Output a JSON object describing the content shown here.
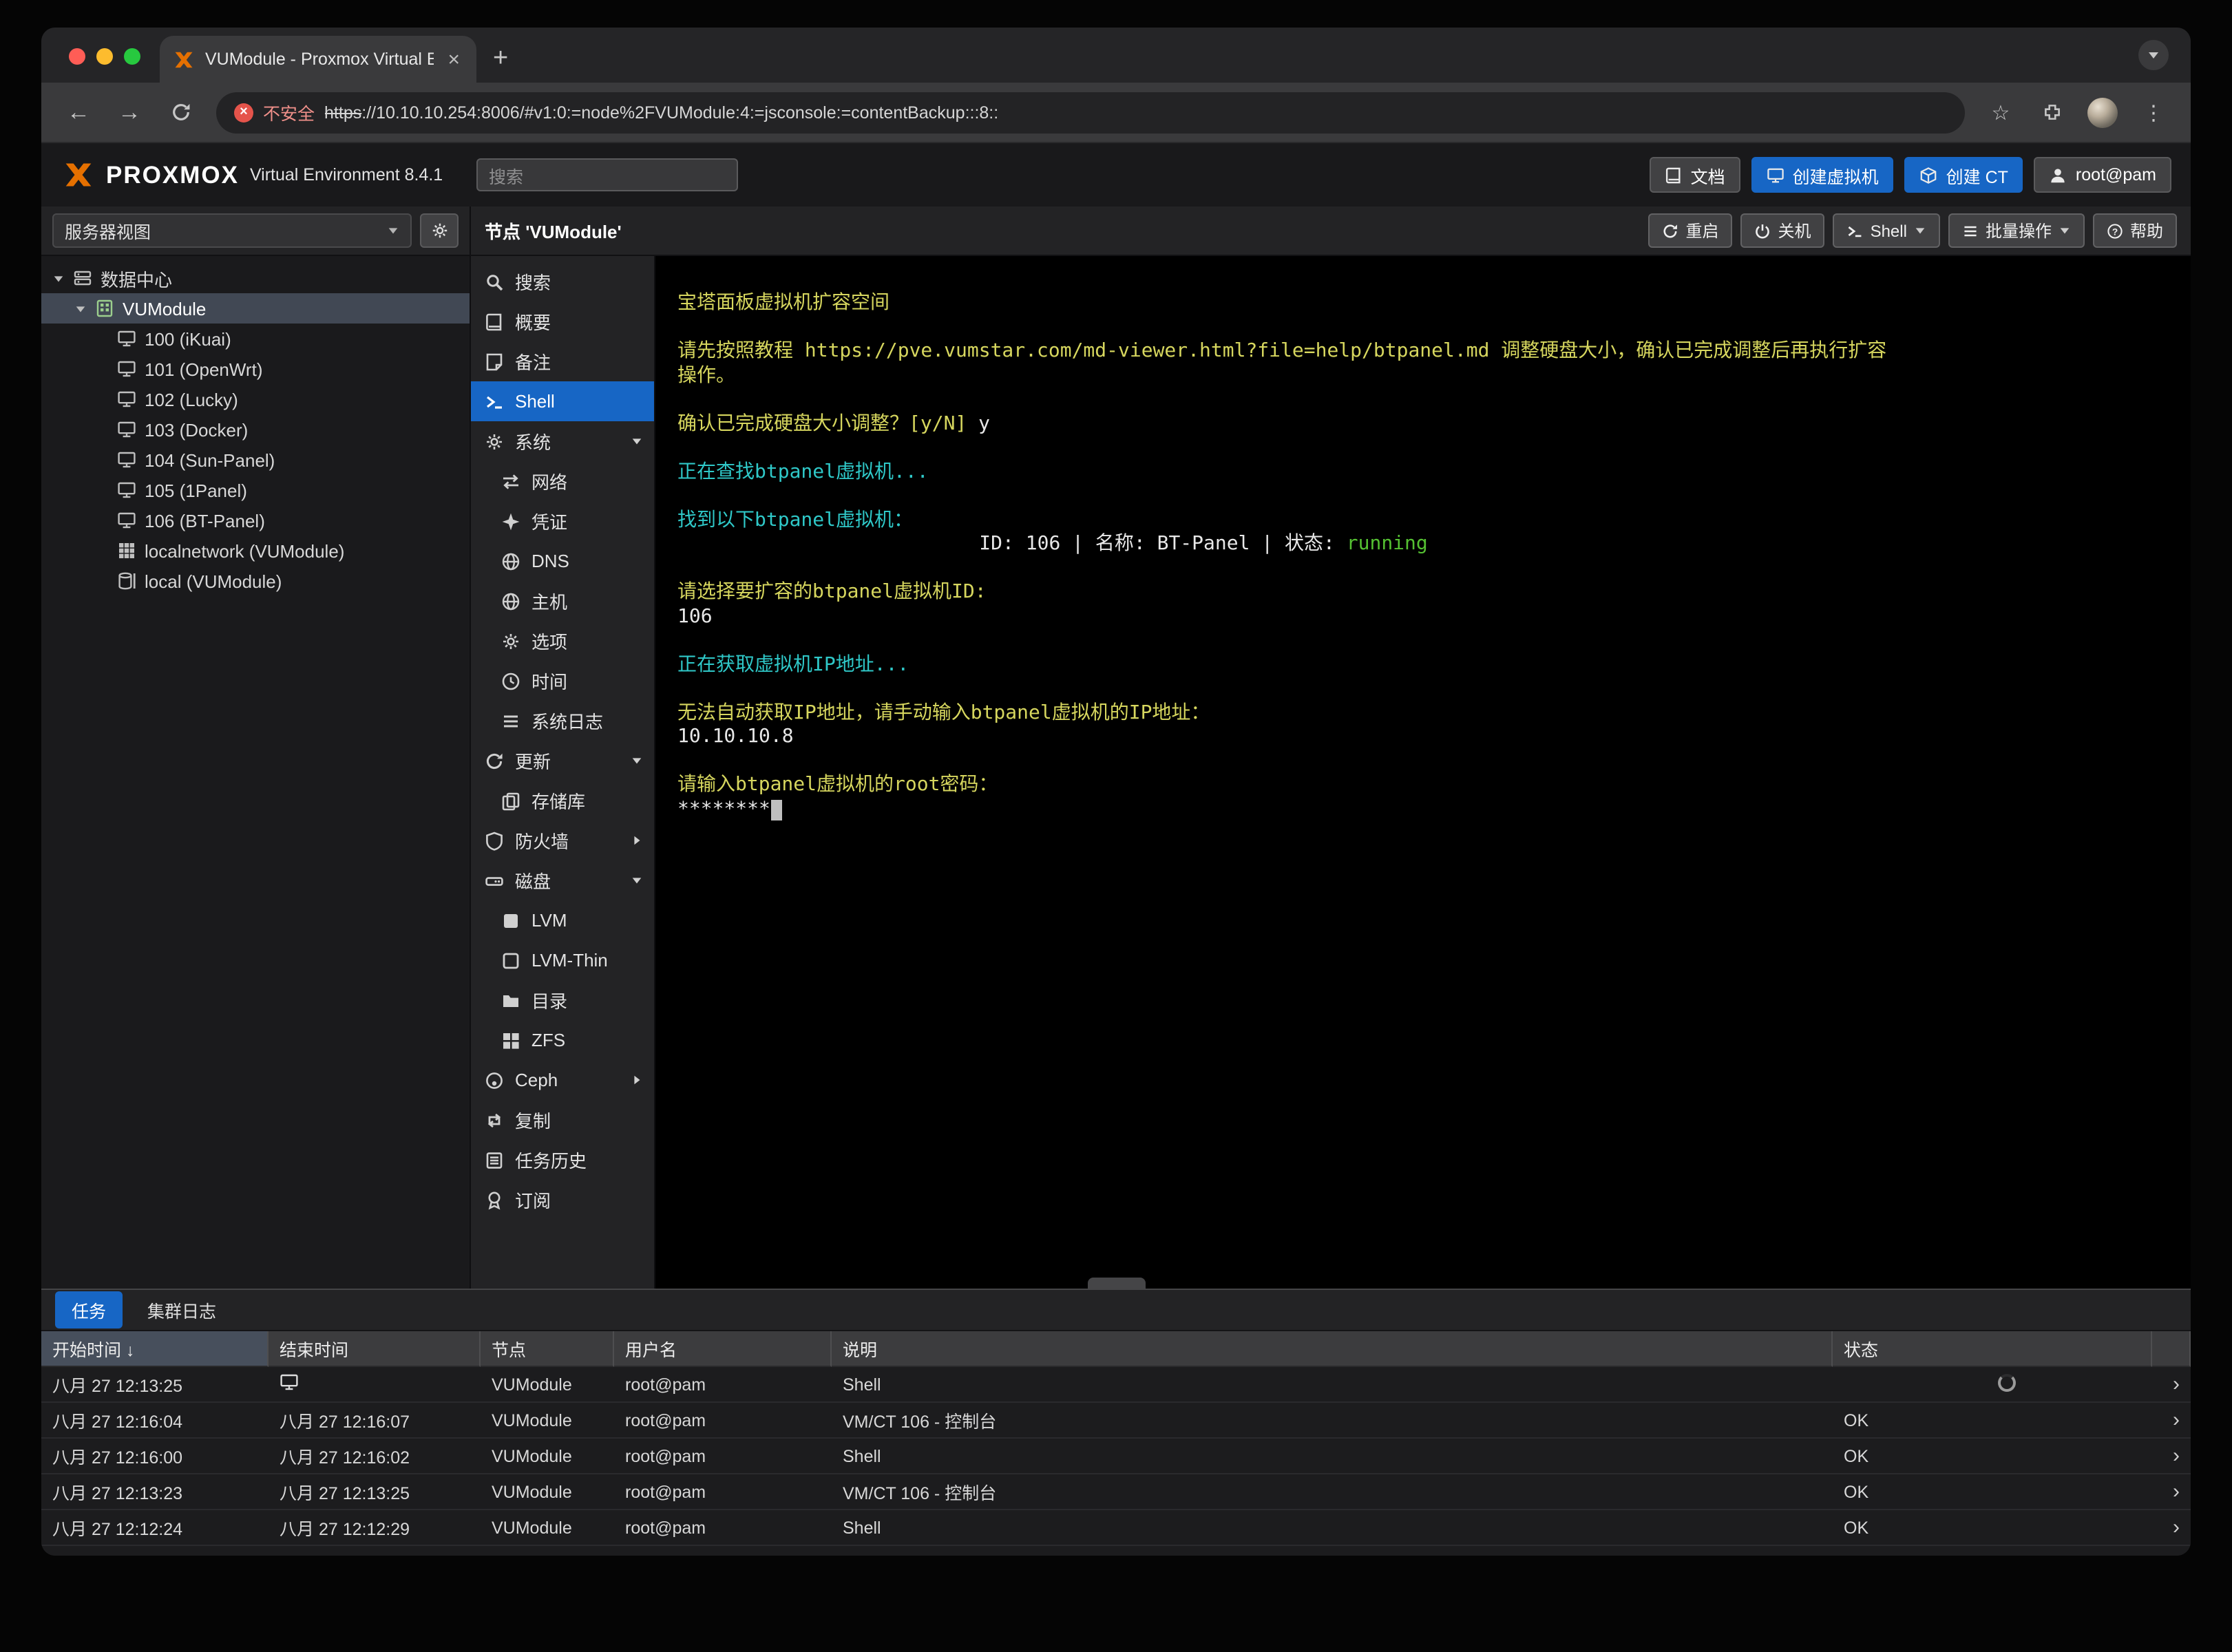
{
  "colors": {
    "accent_blue": "#1766c5",
    "brand_orange": "#e57000",
    "insecure_red": "#e5544b"
  },
  "browser": {
    "tab_title": "VUModule - Proxmox Virtual E",
    "close": "×",
    "new_tab": "+",
    "security_badge": "不安全",
    "url_scheme": "https",
    "url_rest": "://10.10.10.254:8006/#v1:0:=node%2FVUModule:4:=jsconsole:=contentBackup:::8::"
  },
  "pve_header": {
    "brand": "PROXMOX",
    "version": "Virtual Environment 8.4.1",
    "search_placeholder": "搜索",
    "buttons": [
      {
        "id": "documentation-button",
        "icon": "book",
        "label": "文档",
        "style": "dark"
      },
      {
        "id": "create-vm-button",
        "icon": "monitor",
        "label": "创建虚拟机",
        "style": "blue"
      },
      {
        "id": "create-ct-button",
        "icon": "cube",
        "label": "创建 CT",
        "style": "blue"
      },
      {
        "id": "user-menu-button",
        "icon": "user",
        "label": "root@pam",
        "style": "dark"
      }
    ]
  },
  "sidebar": {
    "view_label": "服务器视图",
    "tree": [
      {
        "id": "tree-item-datacenter",
        "icon": "server",
        "label": "数据中心",
        "level": 0,
        "caret": "down"
      },
      {
        "id": "tree-item-node-vumodule",
        "icon": "node",
        "label": "VUModule",
        "level": 1,
        "caret": "down",
        "selected": true
      },
      {
        "id": "tree-item-vm-100",
        "icon": "monitor",
        "label": "100 (iKuai)",
        "level": 2
      },
      {
        "id": "tree-item-vm-101",
        "icon": "monitor",
        "label": "101 (OpenWrt)",
        "level": 2
      },
      {
        "id": "tree-item-vm-102",
        "icon": "monitor",
        "label": "102 (Lucky)",
        "level": 2
      },
      {
        "id": "tree-item-vm-103",
        "icon": "monitor",
        "label": "103 (Docker)",
        "level": 2
      },
      {
        "id": "tree-item-vm-104",
        "icon": "monitor",
        "label": "104 (Sun-Panel)",
        "level": 2
      },
      {
        "id": "tree-item-vm-105",
        "icon": "monitor",
        "label": "105 (1Panel)",
        "level": 2
      },
      {
        "id": "tree-item-vm-106",
        "icon": "monitor",
        "label": "106 (BT-Panel)",
        "level": 2
      },
      {
        "id": "tree-item-storage-localnetwork",
        "icon": "netgrid",
        "label": "localnetwork (VUModule)",
        "level": 2
      },
      {
        "id": "tree-item-storage-local",
        "icon": "storage",
        "label": "local (VUModule)",
        "level": 2
      }
    ]
  },
  "node_panel": {
    "title": "节点 'VUModule'",
    "actions": [
      {
        "id": "restart-button",
        "icon": "refresh",
        "label": "重启"
      },
      {
        "id": "shutdown-button",
        "icon": "power",
        "label": "关机"
      },
      {
        "id": "shell-button",
        "icon": "terminal",
        "label": "Shell",
        "caret": true
      },
      {
        "id": "bulk-actions-button",
        "icon": "list",
        "label": "批量操作",
        "caret": true
      },
      {
        "id": "help-button",
        "icon": "help",
        "label": "帮助"
      }
    ]
  },
  "node_menu": {
    "items": [
      {
        "id": "menu-item-search",
        "icon": "search",
        "label": "搜索"
      },
      {
        "id": "menu-item-summary",
        "icon": "book",
        "label": "概要"
      },
      {
        "id": "menu-item-notes",
        "icon": "note",
        "label": "备注"
      },
      {
        "id": "menu-item-shell",
        "icon": "terminal",
        "label": "Shell",
        "selected": true
      },
      {
        "id": "menu-item-system",
        "icon": "cogs",
        "label": "系统",
        "caret": "down"
      },
      {
        "id": "menu-item-network",
        "icon": "exchange",
        "label": "网络",
        "child": true
      },
      {
        "id": "menu-item-certificates",
        "icon": "cert",
        "label": "凭证",
        "child": true
      },
      {
        "id": "menu-item-dns",
        "icon": "globe",
        "label": "DNS",
        "child": true
      },
      {
        "id": "menu-item-hosts",
        "icon": "globe",
        "label": "主机",
        "child": true
      },
      {
        "id": "menu-item-options",
        "icon": "gear",
        "label": "选项",
        "child": true
      },
      {
        "id": "menu-item-time",
        "icon": "clock",
        "label": "时间",
        "child": true
      },
      {
        "id": "menu-item-syslog",
        "icon": "list",
        "label": "系统日志",
        "child": true
      },
      {
        "id": "menu-item-updates",
        "icon": "refresh",
        "label": "更新",
        "caret": "down"
      },
      {
        "id": "menu-item-repositories",
        "icon": "copy",
        "label": "存储库",
        "child": true
      },
      {
        "id": "menu-item-firewall",
        "icon": "shield",
        "label": "防火墙",
        "caret": "right"
      },
      {
        "id": "menu-item-disks",
        "icon": "hdd",
        "label": "磁盘",
        "caret": "down"
      },
      {
        "id": "menu-item-lvm",
        "icon": "sq",
        "label": "LVM",
        "child": true
      },
      {
        "id": "menu-item-lvmthin",
        "icon": "sqo",
        "label": "LVM-Thin",
        "child": true
      },
      {
        "id": "menu-item-directory",
        "icon": "folder",
        "label": "目录",
        "child": true
      },
      {
        "id": "menu-item-zfs",
        "icon": "grid",
        "label": "ZFS",
        "child": true
      },
      {
        "id": "menu-item-ceph",
        "icon": "ceph",
        "label": "Ceph",
        "caret": "right"
      },
      {
        "id": "menu-item-replication",
        "icon": "retweet",
        "label": "复制"
      },
      {
        "id": "menu-item-task-history",
        "icon": "tasks",
        "label": "任务历史"
      },
      {
        "id": "menu-item-subscription",
        "icon": "badge",
        "label": "订阅"
      }
    ]
  },
  "terminal": {
    "colors": {
      "y": "#d6d65e",
      "c": "#2fc8c8",
      "w": "#e8e8e8",
      "g": "#55c132"
    },
    "lines": [
      [
        {
          "t": "宝塔面板虚拟机扩容空间",
          "c": "y"
        }
      ],
      [],
      [
        {
          "t": "请先按照教程 https://pve.vumstar.com/md-viewer.html?file=help/btpanel.md 调整硬盘大小，确认已完成调整后再执行扩容",
          "c": "y"
        }
      ],
      [
        {
          "t": "操作。",
          "c": "y"
        }
      ],
      [],
      [
        {
          "t": "确认已完成硬盘大小调整？[y/N] ",
          "c": "y"
        },
        {
          "t": "y",
          "c": "w"
        }
      ],
      [],
      [
        {
          "t": "正在查找btpanel虚拟机...",
          "c": "c"
        }
      ],
      [],
      [
        {
          "t": "找到以下btpanel虚拟机：",
          "c": "c"
        }
      ],
      [
        {
          "t": "                          ID: 106 | 名称: BT-Panel | 状态: ",
          "c": "w"
        },
        {
          "t": "running",
          "c": "g"
        }
      ],
      [],
      [
        {
          "t": "请选择要扩容的btpanel虚拟机ID:",
          "c": "y"
        }
      ],
      [
        {
          "t": "106",
          "c": "w"
        }
      ],
      [],
      [
        {
          "t": "正在获取虚拟机IP地址...",
          "c": "c"
        }
      ],
      [],
      [
        {
          "t": "无法自动获取IP地址，请手动输入btpanel虚拟机的IP地址：",
          "c": "y"
        }
      ],
      [
        {
          "t": "10.10.10.8",
          "c": "w"
        }
      ],
      [],
      [
        {
          "t": "请输入btpanel虚拟机的root密码：",
          "c": "y"
        }
      ],
      [
        {
          "t": "********",
          "c": "w",
          "cursor": true
        }
      ]
    ]
  },
  "task_panel": {
    "tabs": [
      {
        "id": "tasks-tab",
        "label": "任务",
        "active": true
      },
      {
        "id": "cluster-log-tab",
        "label": "集群日志",
        "active": false
      }
    ],
    "columns": [
      {
        "id": "start-time",
        "label": "开始时间",
        "sort": "desc"
      },
      {
        "id": "end-time",
        "label": "结束时间"
      },
      {
        "id": "node",
        "label": "节点"
      },
      {
        "id": "user",
        "label": "用户名"
      },
      {
        "id": "description",
        "label": "说明"
      },
      {
        "id": "status",
        "label": "状态"
      }
    ],
    "rows": [
      {
        "start": "八月 27 12:13:25",
        "end": "",
        "end_icon": true,
        "node": "VUModule",
        "user": "root@pam",
        "desc": "Shell",
        "status": "",
        "spinner": true
      },
      {
        "start": "八月 27 12:16:04",
        "end": "八月 27 12:16:07",
        "node": "VUModule",
        "user": "root@pam",
        "desc": "VM/CT 106 - 控制台",
        "status": "OK"
      },
      {
        "start": "八月 27 12:16:00",
        "end": "八月 27 12:16:02",
        "node": "VUModule",
        "user": "root@pam",
        "desc": "Shell",
        "status": "OK"
      },
      {
        "start": "八月 27 12:13:23",
        "end": "八月 27 12:13:25",
        "node": "VUModule",
        "user": "root@pam",
        "desc": "VM/CT 106 - 控制台",
        "status": "OK"
      },
      {
        "start": "八月 27 12:12:24",
        "end": "八月 27 12:12:29",
        "node": "VUModule",
        "user": "root@pam",
        "desc": "Shell",
        "status": "OK"
      }
    ]
  }
}
